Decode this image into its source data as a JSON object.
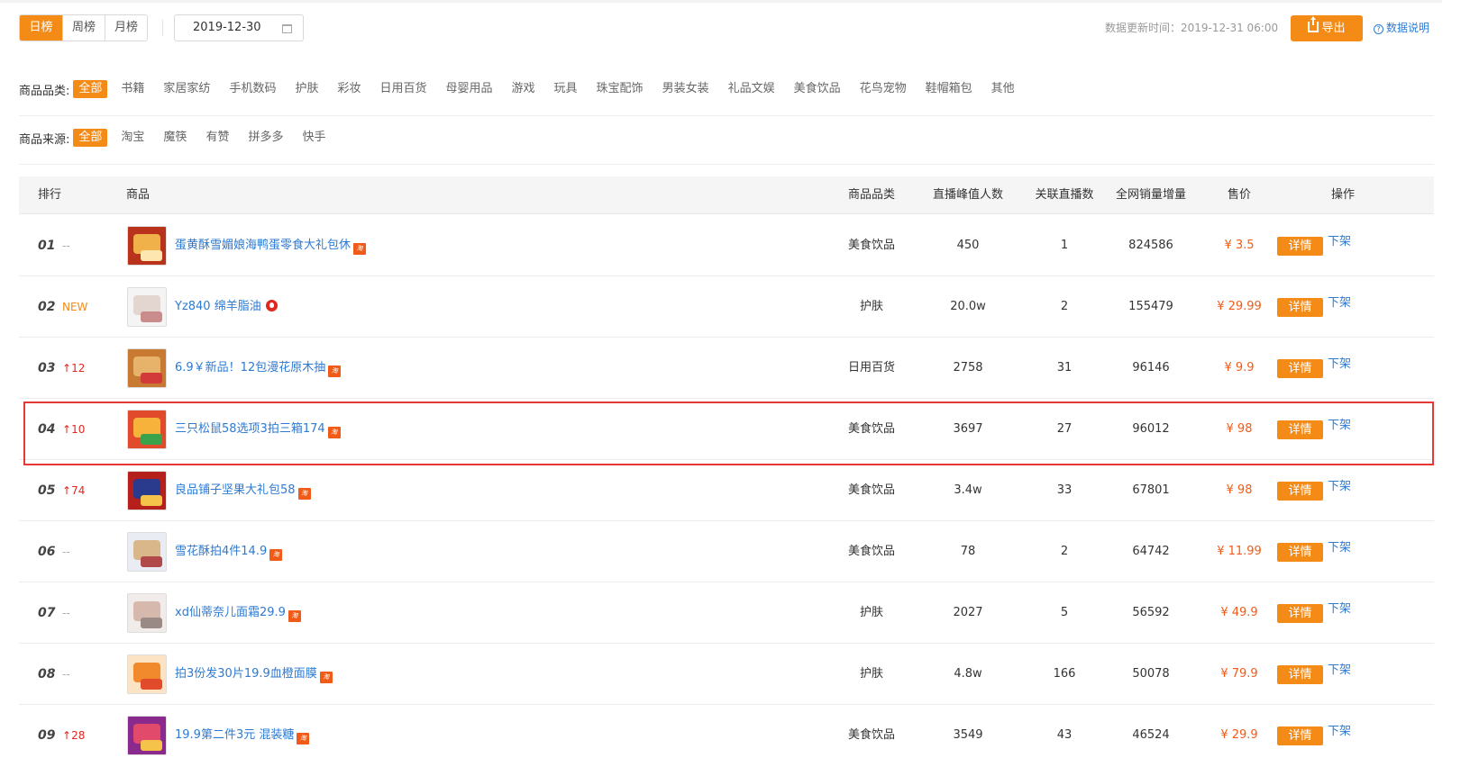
{
  "tabs": [
    {
      "label": "日榜",
      "active": true
    },
    {
      "label": "周榜",
      "active": false
    },
    {
      "label": "月榜",
      "active": false
    }
  ],
  "date": "2019-12-30",
  "update_time": "数据更新时间：2019-12-31 06:00",
  "export_label": "导出",
  "help_label": "数据说明",
  "category_filter": {
    "label": "商品品类:",
    "options": [
      "全部",
      "书籍",
      "家居家纺",
      "手机数码",
      "护肤",
      "彩妆",
      "日用百货",
      "母婴用品",
      "游戏",
      "玩具",
      "珠宝配饰",
      "男装女装",
      "礼品文娱",
      "美食饮品",
      "花鸟宠物",
      "鞋帽箱包",
      "其他"
    ],
    "selected": "全部"
  },
  "source_filter": {
    "label": "商品来源:",
    "options": [
      "全部",
      "淘宝",
      "魔筷",
      "有赞",
      "拼多多",
      "快手"
    ],
    "selected": "全部"
  },
  "table": {
    "headers": {
      "rank": "排行",
      "product": "商品",
      "category": "商品品类",
      "peak": "直播峰值人数",
      "lives": "关联直播数",
      "sales": "全网销量增量",
      "price": "售价",
      "action": "操作"
    },
    "detail_label": "详情",
    "off_label": "下架",
    "rows": [
      {
        "rank": "01",
        "change": "--",
        "change_type": "none",
        "name": "蛋黄酥雪媚娘海鸭蛋零食大礼包休",
        "badge": "taobao",
        "category": "美食饮品",
        "peak": "450",
        "lives": "1",
        "sales": "824586",
        "price": "¥ 3.5",
        "thumb_colors": [
          "#b8321c",
          "#f0b04a",
          "#fde6b0"
        ]
      },
      {
        "rank": "02",
        "change": "NEW",
        "change_type": "new",
        "name": "Yz840 绵羊脂油",
        "badge": "hot",
        "category": "护肤",
        "peak": "20.0w",
        "lives": "2",
        "sales": "155479",
        "price": "¥ 29.99",
        "thumb_colors": [
          "#f4f4f4",
          "#e3d6d0",
          "#c98b8b"
        ]
      },
      {
        "rank": "03",
        "change": "12",
        "change_type": "up",
        "name": "6.9￥新品！12包漫花原木抽",
        "badge": "taobao",
        "category": "日用百货",
        "peak": "2758",
        "lives": "31",
        "sales": "96146",
        "price": "¥ 9.9",
        "thumb_colors": [
          "#c87a32",
          "#e7b36a",
          "#d23a3a"
        ]
      },
      {
        "rank": "04",
        "change": "10",
        "change_type": "up",
        "name": "三只松鼠58选项3拍三箱174",
        "badge": "taobao",
        "category": "美食饮品",
        "peak": "3697",
        "lives": "27",
        "sales": "96012",
        "price": "¥ 98",
        "thumb_colors": [
          "#e24a2c",
          "#f7b23b",
          "#3aa24a"
        ]
      },
      {
        "rank": "05",
        "change": "74",
        "change_type": "up",
        "name": "良品铺子坚果大礼包58",
        "badge": "taobao",
        "category": "美食饮品",
        "peak": "3.4w",
        "lives": "33",
        "sales": "67801",
        "price": "¥ 98",
        "thumb_colors": [
          "#b5201d",
          "#2a3a8c",
          "#f5c24a"
        ]
      },
      {
        "rank": "06",
        "change": "--",
        "change_type": "none",
        "name": "雪花酥拍4件14.9",
        "badge": "taobao",
        "category": "美食饮品",
        "peak": "78",
        "lives": "2",
        "sales": "64742",
        "price": "¥ 11.99",
        "thumb_colors": [
          "#e9ecf2",
          "#d9b78a",
          "#b04a4a"
        ]
      },
      {
        "rank": "07",
        "change": "--",
        "change_type": "none",
        "name": "xd仙蒂奈儿面霜29.9",
        "badge": "taobao",
        "category": "护肤",
        "peak": "2027",
        "lives": "5",
        "sales": "56592",
        "price": "¥ 49.9",
        "thumb_colors": [
          "#f1ece9",
          "#d6b8ad",
          "#9a8a86"
        ]
      },
      {
        "rank": "08",
        "change": "--",
        "change_type": "none",
        "name": "拍3份发30片19.9血橙面膜",
        "badge": "taobao",
        "category": "护肤",
        "peak": "4.8w",
        "lives": "166",
        "sales": "50078",
        "price": "¥ 79.9",
        "thumb_colors": [
          "#fbe3c4",
          "#f08a2c",
          "#e24a2c"
        ]
      },
      {
        "rank": "09",
        "change": "28",
        "change_type": "up",
        "name": "19.9第二件3元 混装糖",
        "badge": "taobao",
        "category": "美食饮品",
        "peak": "3549",
        "lives": "43",
        "sales": "46524",
        "price": "¥ 29.9",
        "thumb_colors": [
          "#8a2a8c",
          "#e24a6c",
          "#f5c24a"
        ]
      }
    ]
  }
}
